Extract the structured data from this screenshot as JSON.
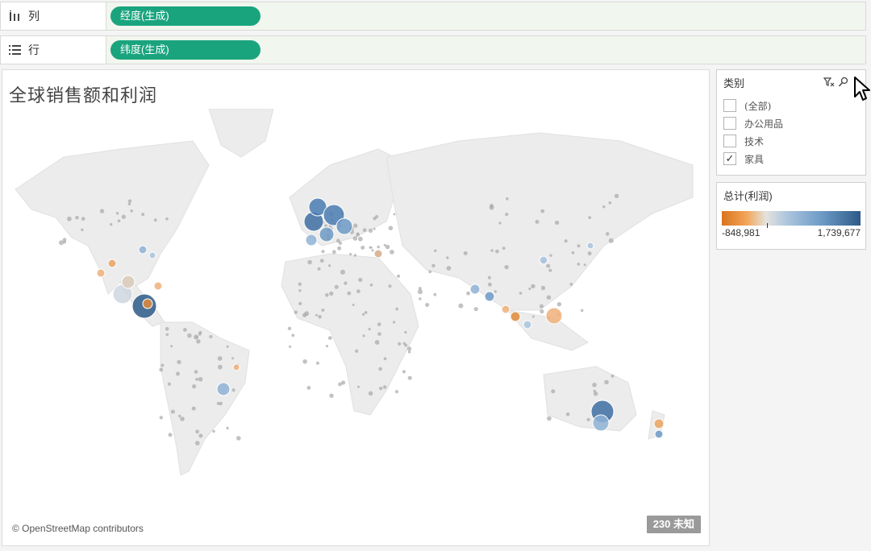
{
  "shelves": {
    "columns": {
      "label": "列",
      "pill": "经度(生成)"
    },
    "rows": {
      "label": "行",
      "pill": "纬度(生成)"
    }
  },
  "view": {
    "title": "全球销售额和利润",
    "attribution": "© OpenStreetMap contributors",
    "unknown_badge": "230 未知"
  },
  "filter": {
    "title": "类别",
    "items": [
      {
        "label": "(全部)",
        "checked": false
      },
      {
        "label": "办公用品",
        "checked": false
      },
      {
        "label": "技术",
        "checked": false
      },
      {
        "label": "家具",
        "checked": true
      }
    ],
    "check_glyph": "✓"
  },
  "legend": {
    "title": "总计(利润)",
    "min": "-848,981",
    "max": "1,739,677",
    "color_low": "#d9741f",
    "color_mid": "#e4e2de",
    "color_high": "#2d5a88"
  },
  "colors": {
    "pill": "#1aa47e",
    "shelf_drop": "#f1f6ee",
    "land": "#ececec",
    "neutral_mark": "#a8a8a8"
  }
}
